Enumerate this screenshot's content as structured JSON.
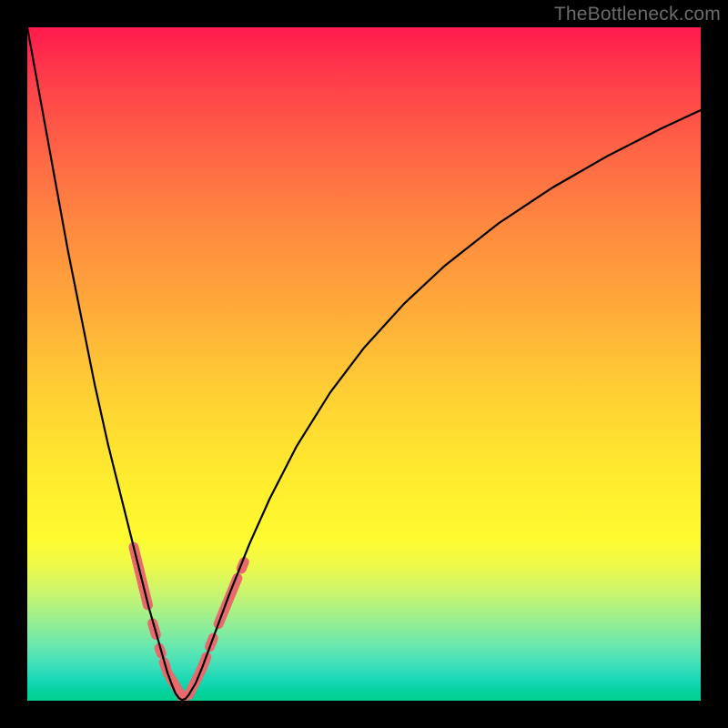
{
  "watermark": "TheBottleneck.com",
  "colors": {
    "background": "#000000",
    "curve": "#000000",
    "overlay": "#e96a6d"
  },
  "chart_data": {
    "type": "line",
    "title": "",
    "xlabel": "",
    "ylabel": "",
    "xlim": [
      0,
      100
    ],
    "ylim": [
      0,
      100
    ],
    "grid": false,
    "legend": false,
    "series": [
      {
        "name": "bottleneck-curve",
        "x": [
          0,
          2,
          4,
          6,
          8,
          10,
          12,
          14,
          16,
          18,
          19,
          20,
          20.8,
          21.5,
          22,
          22.5,
          23,
          23.5,
          24,
          25,
          26,
          28,
          30,
          33,
          36,
          40,
          45,
          50,
          56,
          62,
          70,
          78,
          86,
          94,
          100
        ],
        "y": [
          100,
          89,
          78,
          67,
          57,
          47,
          38,
          30,
          22,
          14,
          10.5,
          7,
          4.2,
          2.3,
          1.1,
          0.4,
          0.1,
          0.3,
          0.9,
          2.6,
          5.0,
          10.4,
          15.8,
          23.3,
          30.0,
          37.8,
          45.8,
          52.4,
          59.0,
          64.6,
          70.9,
          76.2,
          80.8,
          84.9,
          87.7
        ]
      },
      {
        "name": "overlay-segment-left-upper",
        "x": [
          15.8,
          17.9
        ],
        "y": [
          22.8,
          14.2
        ]
      },
      {
        "name": "overlay-segment-left-mid",
        "x": [
          18.6,
          19.1
        ],
        "y": [
          11.5,
          9.8
        ]
      },
      {
        "name": "overlay-segment-left-low1",
        "x": [
          19.6,
          19.9
        ],
        "y": [
          7.8,
          7.0
        ]
      },
      {
        "name": "overlay-segment-left-low2",
        "x": [
          20.3,
          20.6
        ],
        "y": [
          5.7,
          4.8
        ]
      },
      {
        "name": "overlay-segment-bottom",
        "x": [
          20.8,
          23.2
        ],
        "y": [
          4.2,
          0.2
        ]
      },
      {
        "name": "overlay-segment-right-low",
        "x": [
          24.0,
          25.9
        ],
        "y": [
          0.9,
          4.7
        ]
      },
      {
        "name": "overlay-segment-right-mid1",
        "x": [
          25.9,
          26.6
        ],
        "y": [
          4.7,
          6.5
        ]
      },
      {
        "name": "overlay-segment-right-mid2",
        "x": [
          27.1,
          27.6
        ],
        "y": [
          8.0,
          9.3
        ]
      },
      {
        "name": "overlay-segment-right-upper",
        "x": [
          28.4,
          31.2
        ],
        "y": [
          11.4,
          18.2
        ]
      },
      {
        "name": "overlay-segment-right-dot",
        "x": [
          31.8,
          32.2
        ],
        "y": [
          19.6,
          20.6
        ]
      }
    ]
  }
}
